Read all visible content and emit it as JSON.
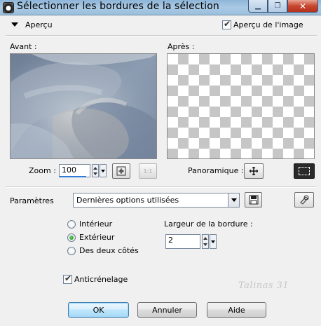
{
  "window": {
    "title": "Sélectionner les bordures de la sélection",
    "minimize_glyph": "▁",
    "restore_glyph": "❐",
    "close_glyph": "✕"
  },
  "preview_section": {
    "label": "Aperçu",
    "expanded": true,
    "preview_image": {
      "label": "Aperçu de l'image",
      "checked": true
    },
    "before_label": "Avant :",
    "after_label": "Après :"
  },
  "zoom": {
    "label": "Zoom :",
    "value": "100",
    "zoom_to_fit_icon": "zoom-fit-icon",
    "actual_size_label": "1:1",
    "panoramique_label": "Panoramique :",
    "pan_icon": "move-cross-icon",
    "selection_preview_icon": "dashed-selection-icon"
  },
  "parameters": {
    "label": "Paramètres",
    "preset_value": "Dernières options utilisées",
    "save_icon": "save-preset-icon",
    "reset_icon": "reset-preset-icon"
  },
  "options": {
    "side": [
      {
        "label": "Intérieur",
        "selected": false
      },
      {
        "label": "Extérieur",
        "selected": true
      },
      {
        "label": "Des deux côtés",
        "selected": false
      }
    ],
    "border_width_label": "Largeur de la bordure :",
    "border_width_value": "2",
    "antialias": {
      "label": "Anticrénelage",
      "checked": true
    }
  },
  "buttons": {
    "ok": "OK",
    "cancel": "Annuler",
    "help": "Aide"
  },
  "watermark": "Talinas 31",
  "colors": {
    "titlebar": "#a9c9e4",
    "close_button": "#c7462f",
    "dialog_bg": "#f0f0f0",
    "checker_gray": "#c6c6c6",
    "default_button_border": "#3c7fb1",
    "radio_selected": "#138a13"
  }
}
